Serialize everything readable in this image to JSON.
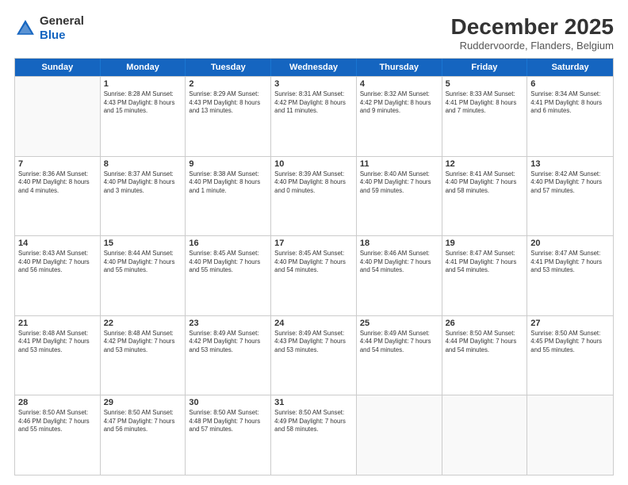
{
  "logo": {
    "line1": "General",
    "line2": "Blue"
  },
  "title": "December 2025",
  "subtitle": "Ruddervoorde, Flanders, Belgium",
  "header_days": [
    "Sunday",
    "Monday",
    "Tuesday",
    "Wednesday",
    "Thursday",
    "Friday",
    "Saturday"
  ],
  "weeks": [
    [
      {
        "day": "",
        "info": ""
      },
      {
        "day": "1",
        "info": "Sunrise: 8:28 AM\nSunset: 4:43 PM\nDaylight: 8 hours\nand 15 minutes."
      },
      {
        "day": "2",
        "info": "Sunrise: 8:29 AM\nSunset: 4:43 PM\nDaylight: 8 hours\nand 13 minutes."
      },
      {
        "day": "3",
        "info": "Sunrise: 8:31 AM\nSunset: 4:42 PM\nDaylight: 8 hours\nand 11 minutes."
      },
      {
        "day": "4",
        "info": "Sunrise: 8:32 AM\nSunset: 4:42 PM\nDaylight: 8 hours\nand 9 minutes."
      },
      {
        "day": "5",
        "info": "Sunrise: 8:33 AM\nSunset: 4:41 PM\nDaylight: 8 hours\nand 7 minutes."
      },
      {
        "day": "6",
        "info": "Sunrise: 8:34 AM\nSunset: 4:41 PM\nDaylight: 8 hours\nand 6 minutes."
      }
    ],
    [
      {
        "day": "7",
        "info": "Sunrise: 8:36 AM\nSunset: 4:40 PM\nDaylight: 8 hours\nand 4 minutes."
      },
      {
        "day": "8",
        "info": "Sunrise: 8:37 AM\nSunset: 4:40 PM\nDaylight: 8 hours\nand 3 minutes."
      },
      {
        "day": "9",
        "info": "Sunrise: 8:38 AM\nSunset: 4:40 PM\nDaylight: 8 hours\nand 1 minute."
      },
      {
        "day": "10",
        "info": "Sunrise: 8:39 AM\nSunset: 4:40 PM\nDaylight: 8 hours\nand 0 minutes."
      },
      {
        "day": "11",
        "info": "Sunrise: 8:40 AM\nSunset: 4:40 PM\nDaylight: 7 hours\nand 59 minutes."
      },
      {
        "day": "12",
        "info": "Sunrise: 8:41 AM\nSunset: 4:40 PM\nDaylight: 7 hours\nand 58 minutes."
      },
      {
        "day": "13",
        "info": "Sunrise: 8:42 AM\nSunset: 4:40 PM\nDaylight: 7 hours\nand 57 minutes."
      }
    ],
    [
      {
        "day": "14",
        "info": "Sunrise: 8:43 AM\nSunset: 4:40 PM\nDaylight: 7 hours\nand 56 minutes."
      },
      {
        "day": "15",
        "info": "Sunrise: 8:44 AM\nSunset: 4:40 PM\nDaylight: 7 hours\nand 55 minutes."
      },
      {
        "day": "16",
        "info": "Sunrise: 8:45 AM\nSunset: 4:40 PM\nDaylight: 7 hours\nand 55 minutes."
      },
      {
        "day": "17",
        "info": "Sunrise: 8:45 AM\nSunset: 4:40 PM\nDaylight: 7 hours\nand 54 minutes."
      },
      {
        "day": "18",
        "info": "Sunrise: 8:46 AM\nSunset: 4:40 PM\nDaylight: 7 hours\nand 54 minutes."
      },
      {
        "day": "19",
        "info": "Sunrise: 8:47 AM\nSunset: 4:41 PM\nDaylight: 7 hours\nand 54 minutes."
      },
      {
        "day": "20",
        "info": "Sunrise: 8:47 AM\nSunset: 4:41 PM\nDaylight: 7 hours\nand 53 minutes."
      }
    ],
    [
      {
        "day": "21",
        "info": "Sunrise: 8:48 AM\nSunset: 4:41 PM\nDaylight: 7 hours\nand 53 minutes."
      },
      {
        "day": "22",
        "info": "Sunrise: 8:48 AM\nSunset: 4:42 PM\nDaylight: 7 hours\nand 53 minutes."
      },
      {
        "day": "23",
        "info": "Sunrise: 8:49 AM\nSunset: 4:42 PM\nDaylight: 7 hours\nand 53 minutes."
      },
      {
        "day": "24",
        "info": "Sunrise: 8:49 AM\nSunset: 4:43 PM\nDaylight: 7 hours\nand 53 minutes."
      },
      {
        "day": "25",
        "info": "Sunrise: 8:49 AM\nSunset: 4:44 PM\nDaylight: 7 hours\nand 54 minutes."
      },
      {
        "day": "26",
        "info": "Sunrise: 8:50 AM\nSunset: 4:44 PM\nDaylight: 7 hours\nand 54 minutes."
      },
      {
        "day": "27",
        "info": "Sunrise: 8:50 AM\nSunset: 4:45 PM\nDaylight: 7 hours\nand 55 minutes."
      }
    ],
    [
      {
        "day": "28",
        "info": "Sunrise: 8:50 AM\nSunset: 4:46 PM\nDaylight: 7 hours\nand 55 minutes."
      },
      {
        "day": "29",
        "info": "Sunrise: 8:50 AM\nSunset: 4:47 PM\nDaylight: 7 hours\nand 56 minutes."
      },
      {
        "day": "30",
        "info": "Sunrise: 8:50 AM\nSunset: 4:48 PM\nDaylight: 7 hours\nand 57 minutes."
      },
      {
        "day": "31",
        "info": "Sunrise: 8:50 AM\nSunset: 4:49 PM\nDaylight: 7 hours\nand 58 minutes."
      },
      {
        "day": "",
        "info": ""
      },
      {
        "day": "",
        "info": ""
      },
      {
        "day": "",
        "info": ""
      }
    ]
  ]
}
